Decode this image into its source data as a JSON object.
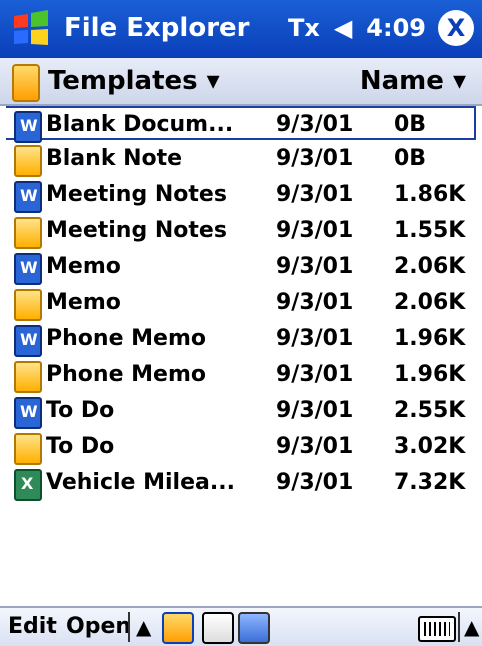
{
  "titlebar": {
    "title": "File Explorer",
    "tray_icon_text": "Tx",
    "volume_icon": "speaker-icon",
    "time": "4:09",
    "close_label": "X"
  },
  "nav": {
    "folder": "Templates ▾",
    "sort": "Name ▾"
  },
  "files": [
    {
      "icon": "word-doc-icon",
      "name": "Blank Docum...",
      "date": "9/3/01",
      "size": "0B",
      "selected": true
    },
    {
      "icon": "note-icon",
      "name": "Blank Note",
      "date": "9/3/01",
      "size": "0B"
    },
    {
      "icon": "word-doc-icon",
      "name": "Meeting Notes",
      "date": "9/3/01",
      "size": "1.86K"
    },
    {
      "icon": "note-icon",
      "name": "Meeting Notes",
      "date": "9/3/01",
      "size": "1.55K"
    },
    {
      "icon": "word-doc-icon",
      "name": "Memo",
      "date": "9/3/01",
      "size": "2.06K"
    },
    {
      "icon": "note-icon",
      "name": "Memo",
      "date": "9/3/01",
      "size": "2.06K"
    },
    {
      "icon": "word-doc-icon",
      "name": "Phone Memo",
      "date": "9/3/01",
      "size": "1.96K"
    },
    {
      "icon": "note-icon",
      "name": "Phone Memo",
      "date": "9/3/01",
      "size": "1.96K"
    },
    {
      "icon": "word-doc-icon",
      "name": "To Do",
      "date": "9/3/01",
      "size": "2.55K"
    },
    {
      "icon": "note-icon",
      "name": "To Do",
      "date": "9/3/01",
      "size": "3.02K"
    },
    {
      "icon": "excel-icon",
      "name": "Vehicle Milea...",
      "date": "9/3/01",
      "size": "7.32K"
    }
  ],
  "menubar": {
    "edit": "Edit",
    "open": "Open",
    "up_arrow": "▲",
    "right_up_arrow": "▲"
  }
}
